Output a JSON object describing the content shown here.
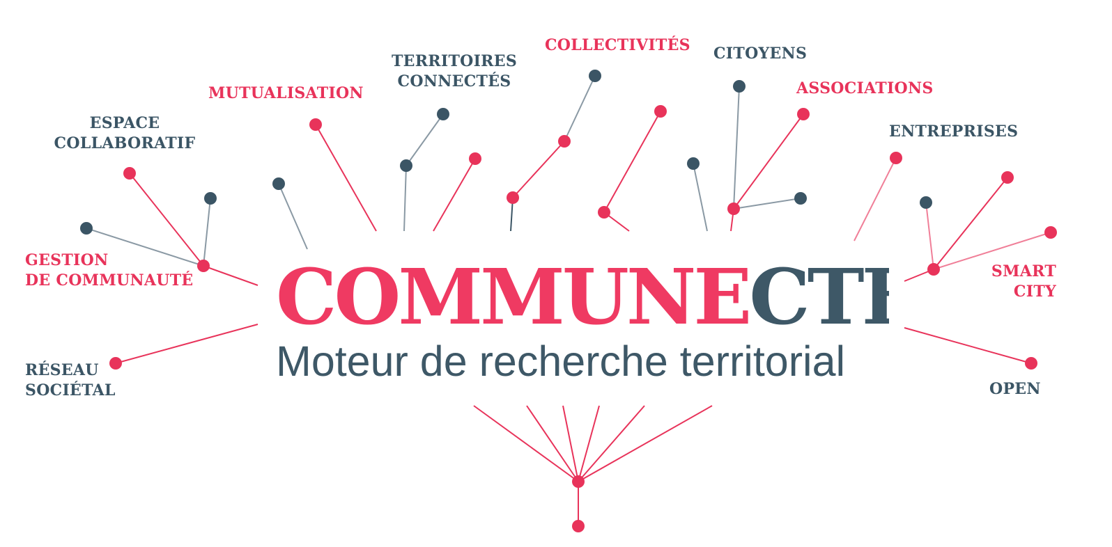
{
  "logo": {
    "part_one": "COMMUNE",
    "part_two": "CTER"
  },
  "tagline": "Moteur de recherche territorial",
  "labels": {
    "mutualisation": "MUTUALISATION",
    "territoires_line1": "TERRITOIRES",
    "territoires_line2": "CONNECTÉS",
    "collectivites": "COLLECTIVITÉS",
    "citoyens": "CITOYENS",
    "associations": "ASSOCIATIONS",
    "espace_line1": "ESPACE",
    "espace_line2": "COLLABORATIF",
    "entreprises": "ENTREPRISES",
    "gestion_line1": "GESTION",
    "gestion_line2": "DE COMMUNAUTÉ",
    "smart_line1": "SMART",
    "smart_line2": "CITY",
    "reseau_line1": "RÉSEAU",
    "reseau_line2": "SOCIÉTAL",
    "open": "OPEN"
  },
  "colors": {
    "accent": "#e8335a",
    "slate": "#3b5565",
    "grey_line": "#8a99a4",
    "light_pink": "#f07f98"
  }
}
